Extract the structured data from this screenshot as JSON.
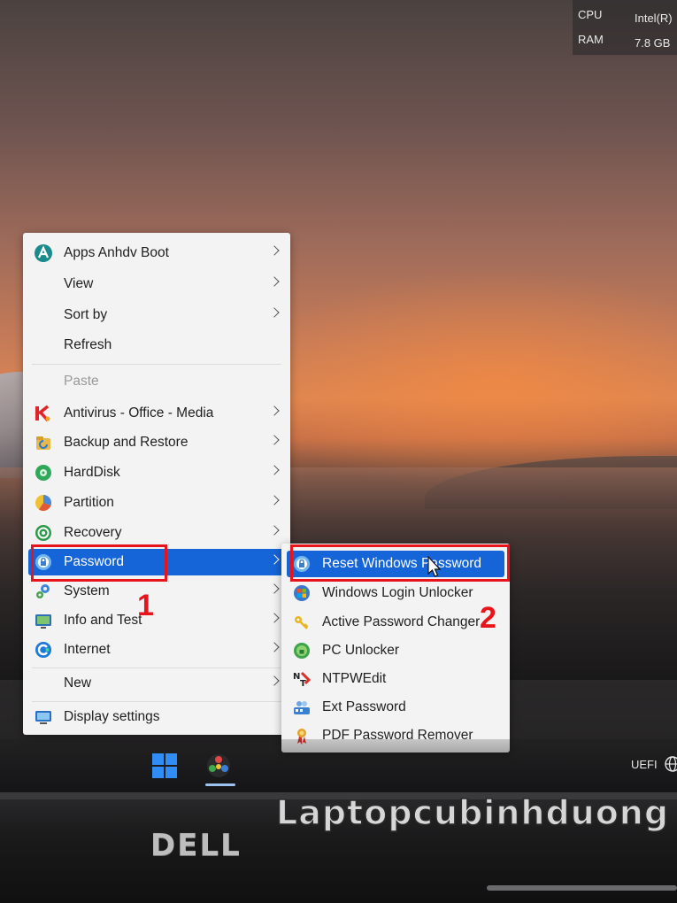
{
  "sysinfo": {
    "cpu_label": "CPU",
    "cpu_value": "Intel(R)",
    "ram_label": "RAM",
    "ram_value": "7.8 GB"
  },
  "context_menu": {
    "items": [
      {
        "label": "Apps Anhdv Boot",
        "icon": "apps-anhdv-icon",
        "submenu": true
      },
      {
        "label": "View",
        "submenu": true
      },
      {
        "label": "Sort by",
        "submenu": true
      },
      {
        "label": "Refresh",
        "submenu": false
      },
      {
        "label": "Paste",
        "submenu": false,
        "disabled": true
      },
      {
        "label": "Antivirus - Office - Media",
        "icon": "kaspersky-icon",
        "submenu": true
      },
      {
        "label": "Backup and Restore",
        "icon": "backup-icon",
        "submenu": true
      },
      {
        "label": "HardDisk",
        "icon": "harddisk-icon",
        "submenu": true
      },
      {
        "label": "Partition",
        "icon": "partition-icon",
        "submenu": true
      },
      {
        "label": "Recovery",
        "icon": "recovery-icon",
        "submenu": true
      },
      {
        "label": "Password",
        "icon": "password-icon",
        "submenu": true,
        "active": true
      },
      {
        "label": "System",
        "icon": "system-gear-icon",
        "submenu": true
      },
      {
        "label": "Info and Test",
        "icon": "info-test-icon",
        "submenu": true
      },
      {
        "label": "Internet",
        "icon": "internet-icon",
        "submenu": true
      },
      {
        "label": "New",
        "submenu": true
      },
      {
        "label": "Display settings",
        "icon": "display-icon",
        "submenu": false
      }
    ]
  },
  "password_submenu": {
    "items": [
      {
        "label": "Reset Windows Password",
        "icon": "reset-password-icon",
        "active": true
      },
      {
        "label": "Windows Login Unlocker",
        "icon": "windows-login-icon"
      },
      {
        "label": "Active Password Changer",
        "icon": "key-icon"
      },
      {
        "label": "PC Unlocker",
        "icon": "pc-unlocker-icon"
      },
      {
        "label": "NTPWEdit",
        "icon": "ntpwedit-icon"
      },
      {
        "label": "Ext Password",
        "icon": "ext-password-icon"
      },
      {
        "label": "PDF Password Remover",
        "icon": "pdf-ribbon-icon"
      }
    ]
  },
  "annotations": {
    "step1": "1",
    "step2": "2",
    "color": "#e8141c"
  },
  "taskbar": {
    "uefi_label": "UEFI"
  },
  "bezel": {
    "brand": "DELL",
    "watermark": "Laptopcubinhduong"
  },
  "colors": {
    "menu_highlight": "#1565d8",
    "menu_background": "#f3f3f3"
  }
}
